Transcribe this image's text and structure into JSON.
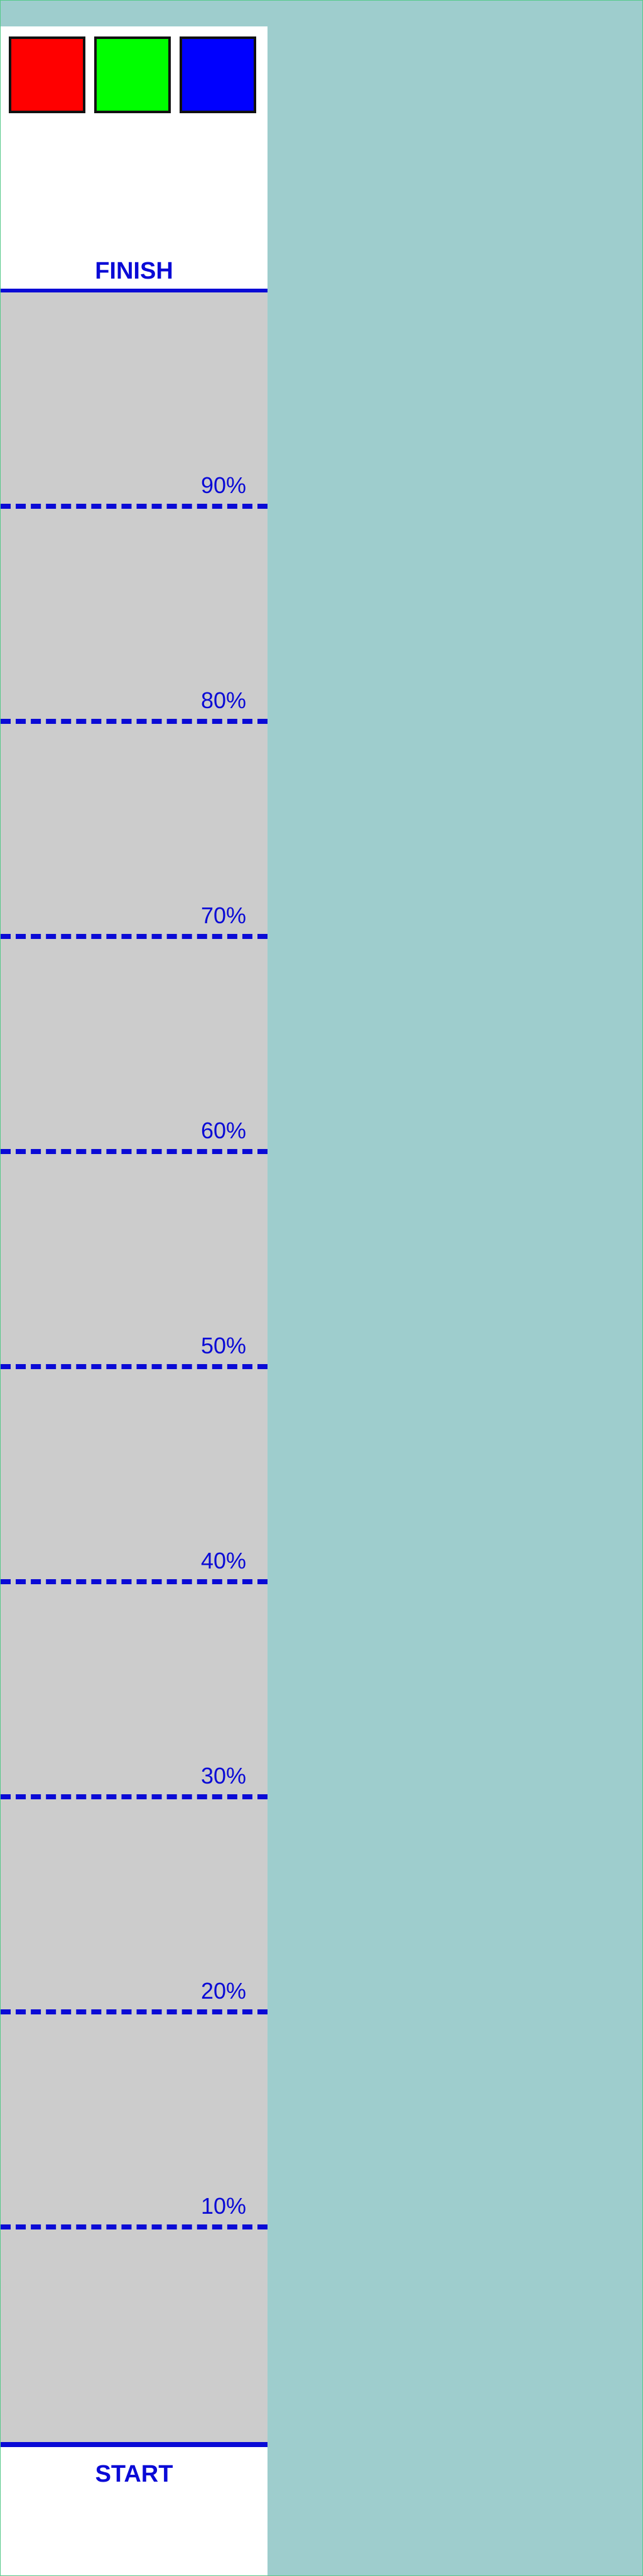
{
  "palette": [
    {
      "name": "red",
      "color": "#ff0000"
    },
    {
      "name": "green",
      "color": "#00ff00"
    },
    {
      "name": "blue",
      "color": "#0000ff"
    }
  ],
  "finish_label": "FINISH",
  "start_label": "START",
  "markers": [
    {
      "label": "90%",
      "value": 90
    },
    {
      "label": "80%",
      "value": 80
    },
    {
      "label": "70%",
      "value": 70
    },
    {
      "label": "60%",
      "value": 60
    },
    {
      "label": "50%",
      "value": 50
    },
    {
      "label": "40%",
      "value": 40
    },
    {
      "label": "30%",
      "value": 30
    },
    {
      "label": "20%",
      "value": 20
    },
    {
      "label": "10%",
      "value": 10
    }
  ],
  "colors": {
    "track": "#cccccc",
    "line": "#0a0ad6",
    "background": "#9ecdcd"
  }
}
